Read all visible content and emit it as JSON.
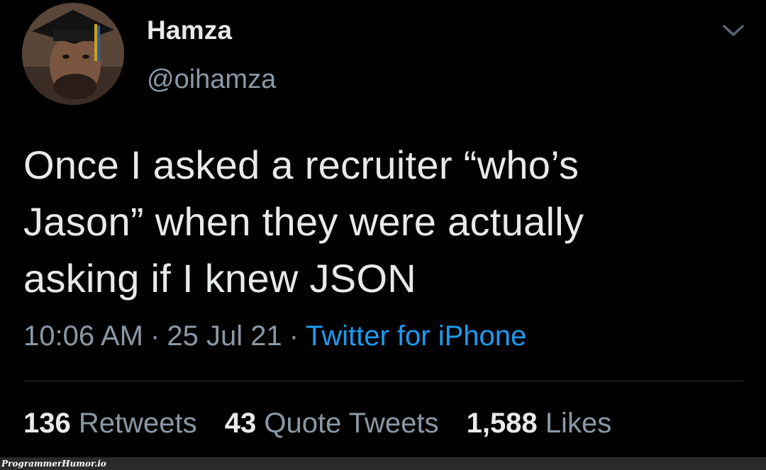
{
  "author": {
    "display_name": "Hamza",
    "handle": "@oihamza"
  },
  "tweet": {
    "text_lines": [
      "Once I asked a recruiter “who’s",
      "Jason” when they were actually",
      "asking if I knew JSON"
    ],
    "time": "10:06 AM",
    "date": "25 Jul 21",
    "separator": "·",
    "source": "Twitter for iPhone"
  },
  "stats": {
    "retweets_count": "136",
    "retweets_label": "Retweets",
    "quotes_count": "43",
    "quotes_label": "Quote Tweets",
    "likes_count": "1,588",
    "likes_label": "Likes"
  },
  "watermark": "ProgrammerHumor.io",
  "icons": {
    "more": "chevron-down-icon"
  },
  "colors": {
    "background": "#000000",
    "text_primary": "#e7e9ea",
    "text_secondary": "#8b98a5",
    "link": "#1d9bf0",
    "divider": "#2f3336"
  }
}
